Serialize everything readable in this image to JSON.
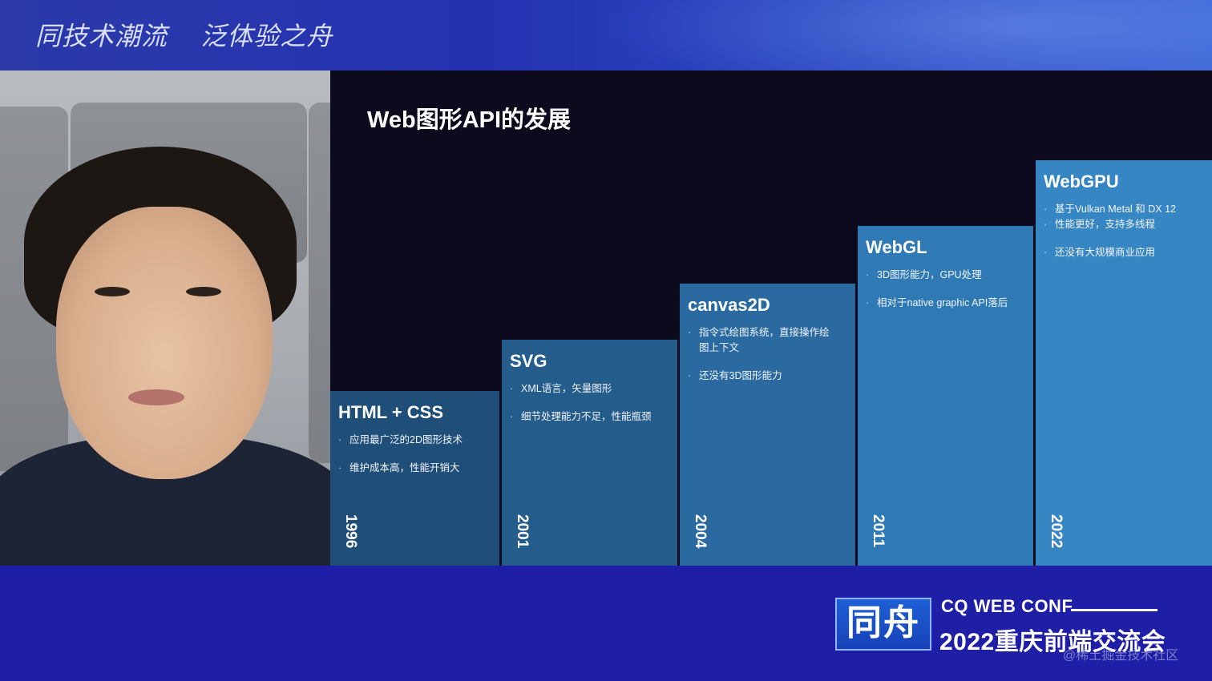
{
  "header": {
    "slogan_left": "同技术潮流",
    "slogan_right": "泛体验之舟"
  },
  "slide": {
    "title": "Web图形API的发展",
    "steps": [
      {
        "title": "HTML + CSS",
        "bullets": [
          "应用最广泛的2D图形技术",
          "维护成本高，性能开销大"
        ],
        "year": "1996",
        "color": "#1f4f78"
      },
      {
        "title": "SVG",
        "bullets": [
          "XML语言，矢量图形",
          "细节处理能力不足，性能瓶颈"
        ],
        "year": "2001",
        "color": "#245c8c"
      },
      {
        "title": "canvas2D",
        "bullets": [
          "指令式绘图系统，直接操作绘图上下文",
          "还没有3D图形能力"
        ],
        "year": "2004",
        "color": "#2a6aa0"
      },
      {
        "title": "WebGL",
        "bullets": [
          "3D图形能力，GPU处理",
          "相对于native graphic API落后"
        ],
        "year": "2011",
        "color": "#2f79b4"
      },
      {
        "title": "WebGPU",
        "bullets": [
          "基于Vulkan Metal 和 DX 12",
          "性能更好，支持多线程",
          "还没有大规模商业应用"
        ],
        "year": "2022",
        "color": "#3786c4"
      }
    ]
  },
  "footer": {
    "logo_text": "同舟",
    "conf_name": "CQ WEB CONF",
    "conf_subtitle": "2022重庆前端交流会",
    "watermark": "@稀土掘金技术社区"
  }
}
